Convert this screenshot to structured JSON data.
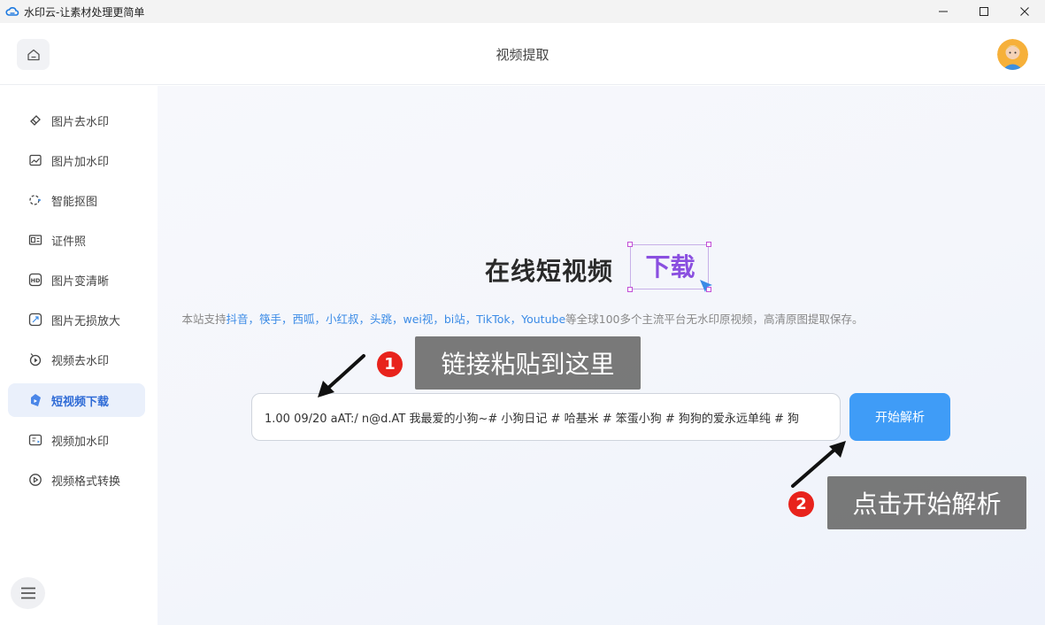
{
  "window": {
    "title": "水印云-让素材处理更简单",
    "icon": "cloud-logo-icon"
  },
  "header": {
    "title": "视频提取",
    "home_icon": "home-icon",
    "avatar": "user-avatar"
  },
  "sidebar": {
    "items": [
      {
        "label": "图片去水印",
        "icon": "eraser-icon",
        "active": false
      },
      {
        "label": "图片加水印",
        "icon": "image-add-icon",
        "active": false
      },
      {
        "label": "智能抠图",
        "icon": "cutout-icon",
        "active": false
      },
      {
        "label": "证件照",
        "icon": "id-photo-icon",
        "active": false
      },
      {
        "label": "图片变清晰",
        "icon": "hd-icon",
        "active": false
      },
      {
        "label": "图片无损放大",
        "icon": "enlarge-icon",
        "active": false
      },
      {
        "label": "视频去水印",
        "icon": "video-eraser-icon",
        "active": false
      },
      {
        "label": "短视频下载",
        "icon": "short-video-download-icon",
        "active": true
      },
      {
        "label": "视频加水印",
        "icon": "video-add-watermark-icon",
        "active": false
      },
      {
        "label": "视频格式转换",
        "icon": "video-convert-icon",
        "active": false
      }
    ],
    "menu_icon": "menu-collapse-icon"
  },
  "main": {
    "hero_title": "在线短视频",
    "hero_highlight": "下载",
    "subtitle_prefix": "本站支持",
    "platforms": "抖音，筷手，西呱，小红叔，头跳，wei视，bi站，TikTok，Youtube",
    "subtitle_suffix": "等全球100多个主流平台无水印原视频，高清原图提取保存。",
    "input_value": "1.00 09/20 aAT:/ n@d.AT 我最爱的小狗~# 小狗日记 # 哈基米 # 笨蛋小狗 # 狗狗的爱永远单纯 # 狗",
    "parse_button": "开始解析"
  },
  "tutorial": {
    "step1_number": "1",
    "step1_text": "链接粘贴到这里",
    "step2_number": "2",
    "step2_text": "点击开始解析"
  },
  "colors": {
    "accent": "#3f9cf7",
    "active_nav_bg": "#eaf0fb",
    "active_nav_text": "#2f6bd6",
    "step_badge": "#e8231c",
    "tip_bg": "#6e6e6e"
  }
}
